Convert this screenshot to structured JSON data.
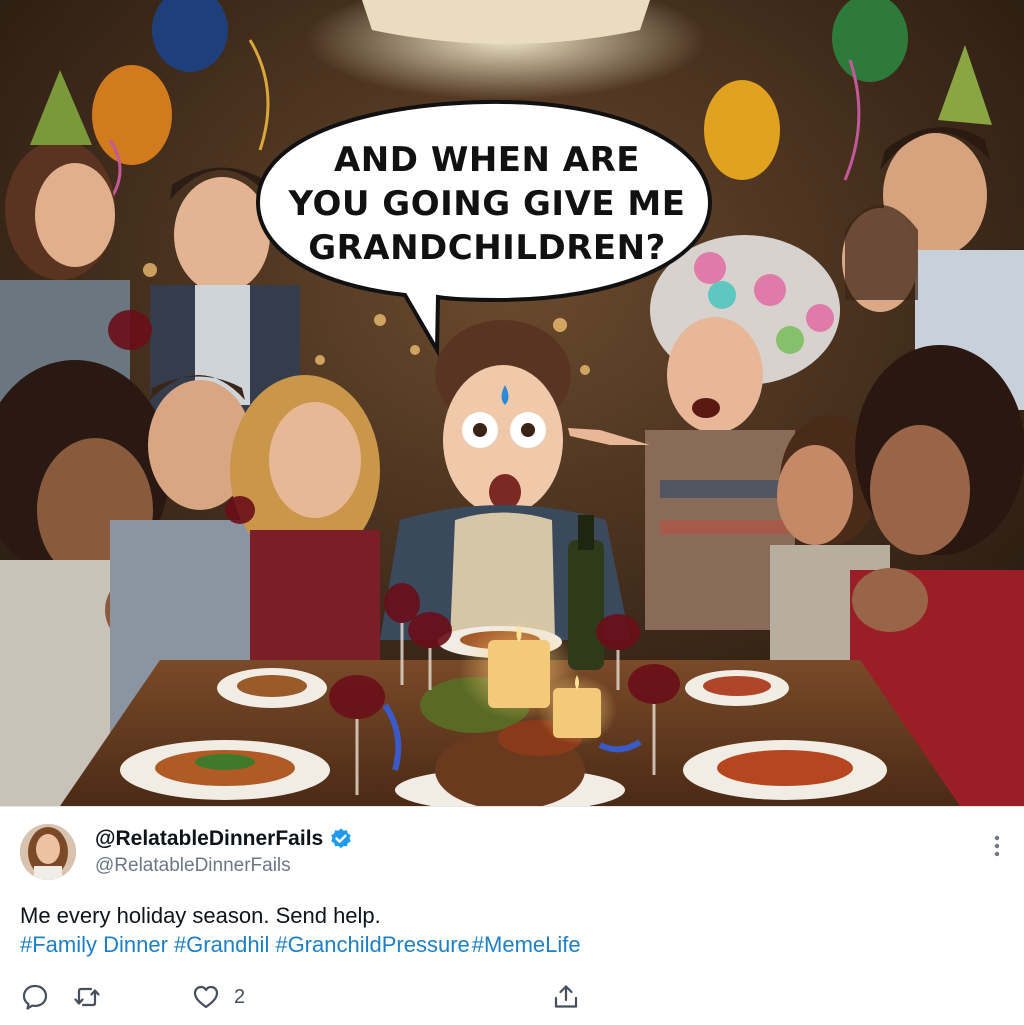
{
  "image": {
    "bubble_text_lines": [
      "AND WHEN ARE",
      "YOU GOING GIVE ME",
      "GRANDCHILDREN?"
    ]
  },
  "post": {
    "display_name": "@RelatableDinnerFails",
    "handle": "@RelatableDinnerFails",
    "verified_icon": "verified-badge-icon",
    "text": "Me every holiday season. Send help.",
    "hashtags": [
      "#Family Dinner",
      "#Grandhil",
      "#GranchildPressure",
      "#MemeLife"
    ],
    "actions": {
      "reply_count": "",
      "retweet_count": "",
      "like_count": "2",
      "share_label": ""
    }
  },
  "colors": {
    "hashtag": "#1d7fc7",
    "verified": "#1d9bf0",
    "text": "#0f1419",
    "muted": "#6b7785"
  }
}
